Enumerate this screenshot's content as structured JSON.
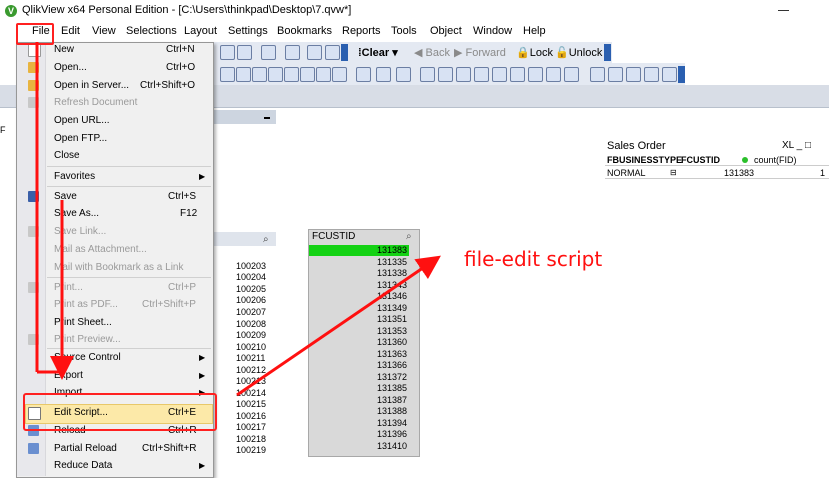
{
  "window": {
    "app_icon": "V",
    "title": "QlikView x64 Personal Edition - [C:\\Users\\thinkpad\\Desktop\\7.qvw*]"
  },
  "menubar": [
    "File",
    "Edit",
    "View",
    "Selections",
    "Layout",
    "Settings",
    "Bookmarks",
    "Reports",
    "Tools",
    "Object",
    "Window",
    "Help"
  ],
  "toolbar": {
    "clear": "Clear",
    "back": "Back",
    "forward": "Forward",
    "lock": "Lock",
    "unlock": "Unlock"
  },
  "file_menu": [
    {
      "label": "New",
      "shortcut": "Ctrl+N",
      "enabled": true,
      "icon": "new-file-icon"
    },
    {
      "label": "Open...",
      "shortcut": "Ctrl+O",
      "enabled": true,
      "icon": "open-folder-icon"
    },
    {
      "label": "Open in Server...",
      "shortcut": "Ctrl+Shift+O",
      "enabled": true,
      "icon": "open-server-icon"
    },
    {
      "label": "Refresh Document",
      "shortcut": "",
      "enabled": false,
      "icon": "refresh-icon"
    },
    {
      "label": "Open URL...",
      "shortcut": "",
      "enabled": true
    },
    {
      "label": "Open FTP...",
      "shortcut": "",
      "enabled": true
    },
    {
      "label": "Close",
      "shortcut": "",
      "enabled": true
    },
    {
      "label": "Favorites",
      "shortcut": "",
      "enabled": true,
      "submenu": true
    },
    {
      "label": "Save",
      "shortcut": "Ctrl+S",
      "enabled": true,
      "icon": "save-icon"
    },
    {
      "label": "Save As...",
      "shortcut": "F12",
      "enabled": true
    },
    {
      "label": "Save Link...",
      "shortcut": "",
      "enabled": false,
      "icon": "save-link-icon"
    },
    {
      "label": "Mail as Attachment...",
      "shortcut": "",
      "enabled": false
    },
    {
      "label": "Mail with Bookmark as a Link",
      "shortcut": "",
      "enabled": false
    },
    {
      "label": "Print...",
      "shortcut": "Ctrl+P",
      "enabled": false,
      "icon": "print-icon"
    },
    {
      "label": "Print as PDF...",
      "shortcut": "Ctrl+Shift+P",
      "enabled": false
    },
    {
      "label": "Print Sheet...",
      "shortcut": "",
      "enabled": true
    },
    {
      "label": "Print Preview...",
      "shortcut": "",
      "enabled": false,
      "icon": "print-preview-icon"
    },
    {
      "label": "Source Control",
      "shortcut": "",
      "enabled": true,
      "submenu": true
    },
    {
      "label": "Export",
      "shortcut": "",
      "enabled": true,
      "submenu": true
    },
    {
      "label": "Import",
      "shortcut": "",
      "enabled": true,
      "submenu": true
    },
    {
      "label": "Edit Script...",
      "shortcut": "Ctrl+E",
      "enabled": true,
      "icon": "edit-script-icon",
      "highlighted": true
    },
    {
      "label": "Reload",
      "shortcut": "Ctrl+R",
      "enabled": true,
      "icon": "reload-icon"
    },
    {
      "label": "Partial Reload",
      "shortcut": "Ctrl+Shift+R",
      "enabled": true,
      "icon": "partial-reload-icon"
    },
    {
      "label": "Reduce Data",
      "shortcut": "",
      "enabled": true,
      "submenu": true
    }
  ],
  "list_left": {
    "values": [
      "100203",
      "100204",
      "100205",
      "100206",
      "100207",
      "100208",
      "100209",
      "100210",
      "100211",
      "100212",
      "100213",
      "100214",
      "100215",
      "100216",
      "100217",
      "100218",
      "100219"
    ]
  },
  "fcustid_list": {
    "title": "FCUSTID",
    "values": [
      "131383",
      "131335",
      "131338",
      "131343",
      "131346",
      "131349",
      "131351",
      "131353",
      "131360",
      "131363",
      "131366",
      "131372",
      "131385",
      "131387",
      "131388",
      "131394",
      "131396",
      "131410"
    ]
  },
  "sales_order": {
    "title": "Sales Order",
    "icons": "XL _ □",
    "columns": [
      "FBUSINESSTYPE",
      "FCUSTID",
      "count(FID)"
    ],
    "row": [
      "NORMAL",
      "131383",
      "1"
    ]
  },
  "annotation": {
    "text": "file-edit script",
    "color": "#ff1010"
  },
  "colors": {
    "selected_green": "#14d214",
    "highlight": "#fce9a8"
  }
}
